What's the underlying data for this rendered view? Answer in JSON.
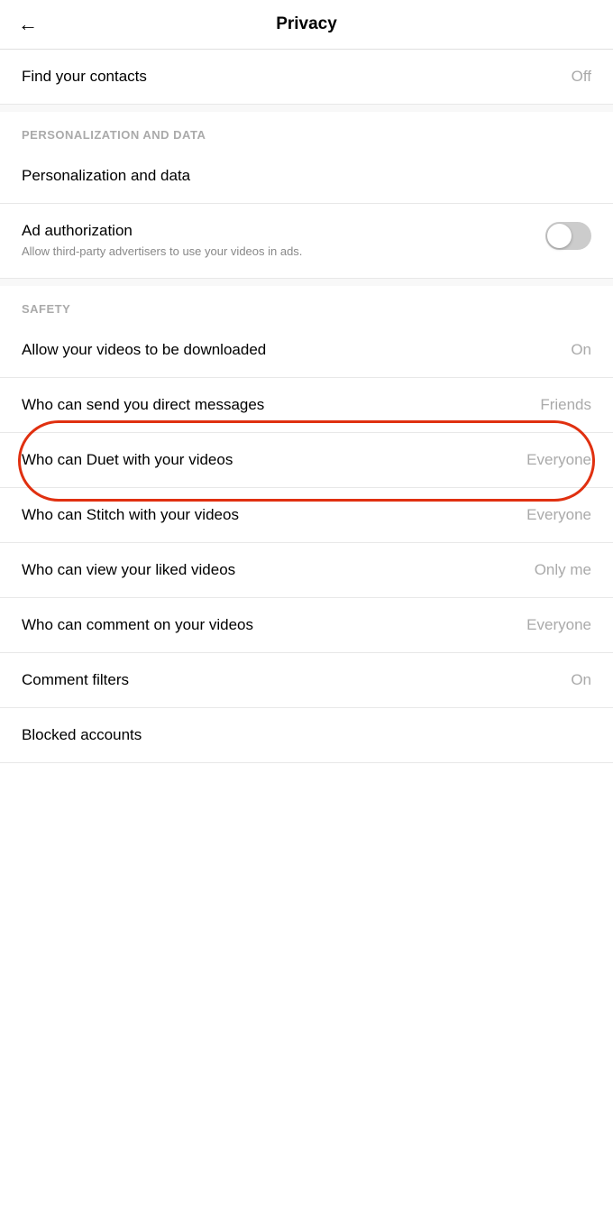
{
  "header": {
    "title": "Privacy",
    "back_label": "←"
  },
  "sections": {
    "contacts": {
      "label": "Find your contacts",
      "value": "Off"
    },
    "personalization": {
      "header": "PERSONALIZATION AND DATA",
      "items": [
        {
          "id": "personalization-data",
          "label": "Personalization and data",
          "value": null,
          "type": "link"
        },
        {
          "id": "ad-authorization",
          "label": "Ad authorization",
          "sub": "Allow third-party advertisers to use your videos in ads.",
          "value": null,
          "type": "toggle",
          "toggle_on": false
        }
      ]
    },
    "safety": {
      "header": "SAFETY",
      "items": [
        {
          "id": "allow-download",
          "label": "Allow your videos to be downloaded",
          "value": "On",
          "type": "value"
        },
        {
          "id": "direct-messages",
          "label": "Who can send you direct messages",
          "value": "Friends",
          "type": "value"
        },
        {
          "id": "duet",
          "label": "Who can Duet with your videos",
          "value": "Everyone",
          "type": "value",
          "highlighted": true
        },
        {
          "id": "stitch",
          "label": "Who can Stitch with your videos",
          "value": "Everyone",
          "type": "value"
        },
        {
          "id": "liked-videos",
          "label": "Who can view your liked videos",
          "value": "Only me",
          "type": "value"
        },
        {
          "id": "comment-videos",
          "label": "Who can comment on your videos",
          "value": "Everyone",
          "type": "value"
        },
        {
          "id": "comment-filters",
          "label": "Comment filters",
          "value": "On",
          "type": "value"
        },
        {
          "id": "blocked-accounts",
          "label": "Blocked accounts",
          "value": null,
          "type": "link"
        }
      ]
    }
  }
}
